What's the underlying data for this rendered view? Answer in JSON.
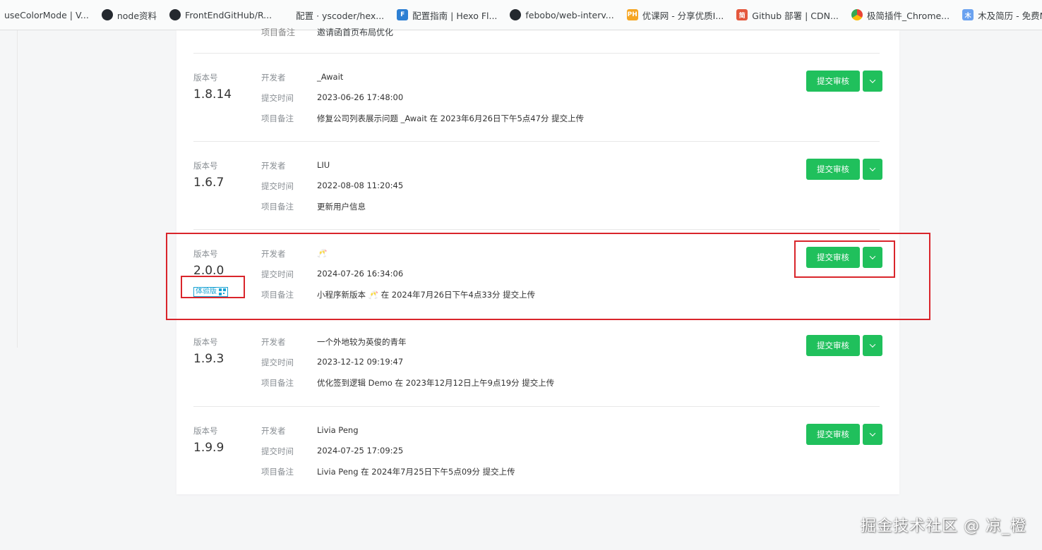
{
  "bookmarks": [
    {
      "label": "useColorMode | V...",
      "icon": "vue-icon"
    },
    {
      "label": "node资料",
      "icon": "github-icon"
    },
    {
      "label": "FrontEndGitHub/R...",
      "icon": "github-icon"
    },
    {
      "label": "配置 · yscoder/hex...",
      "icon": "blank-icon"
    },
    {
      "label": "配置指南 | Hexo Fl...",
      "icon": "hexo-icon"
    },
    {
      "label": "febobo/web-interv...",
      "icon": "github-icon"
    },
    {
      "label": "优课网 - 分享优质I...",
      "icon": "ph-icon"
    },
    {
      "label": "Github 部署 | CDN...",
      "icon": "csdn-icon"
    },
    {
      "label": "极简插件_Chrome...",
      "icon": "chrome-icon"
    },
    {
      "label": "木及简历 - 免费Mar...",
      "icon": "resume-icon"
    },
    {
      "label": "",
      "icon": "extension-icon"
    }
  ],
  "partial_row": {
    "label": "项目备注",
    "value": "邀请函首页布局优化"
  },
  "labels": {
    "version": "版本号",
    "developer": "开发者",
    "submit_time": "提交时间",
    "remark": "项目备注",
    "submit_button": "提交审核",
    "experience_badge": "体验版"
  },
  "versions": [
    {
      "version": "1.8.14",
      "developer": "_Await",
      "time": "2023-06-26 17:48:00",
      "remark": "修复公司列表展示问题 _Await 在 2023年6月26日下午5点47分 提交上传",
      "experience": false
    },
    {
      "version": "1.6.7",
      "developer": "LIU",
      "time": "2022-08-08 11:20:45",
      "remark": "更新用户信息",
      "experience": false
    },
    {
      "version": "2.0.0",
      "developer": "🥂",
      "time": "2024-07-26 16:34:06",
      "remark": "小程序新版本 🥂 在 2024年7月26日下午4点33分 提交上传",
      "experience": true
    },
    {
      "version": "1.9.3",
      "developer": "一个外地较为英俊的青年",
      "time": "2023-12-12 09:19:47",
      "remark": "优化签到逻辑 Demo 在 2023年12月12日上午9点19分 提交上传",
      "experience": false
    },
    {
      "version": "1.9.9",
      "developer": "Livia Peng",
      "time": "2024-07-25 17:09:25",
      "remark": "Livia Peng 在 2024年7月25日下午5点09分 提交上传",
      "experience": false
    }
  ],
  "watermark": "掘金技术社区 @ 凉_橙",
  "colors": {
    "primary": "#20c05c",
    "highlight": "#d9252b",
    "badge": "#1aa3d4"
  }
}
